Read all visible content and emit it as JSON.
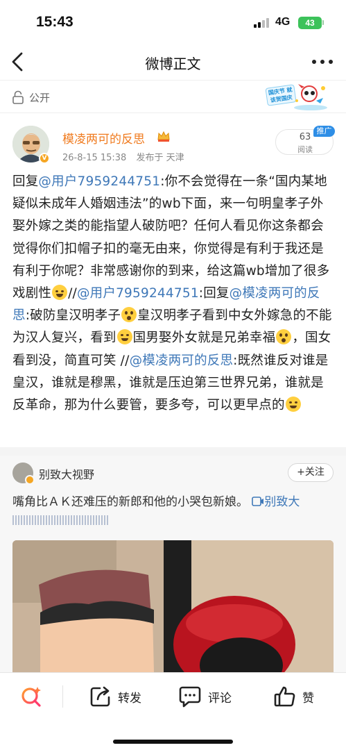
{
  "status_bar": {
    "time": "15:43",
    "network": "4G",
    "battery": "43"
  },
  "nav": {
    "title": "微博正文",
    "back_icon": "chevron-left-icon",
    "more_icon": "more-dots-icon"
  },
  "visibility": {
    "label": "公开",
    "icon": "lock-icon",
    "banner_text": "国庆节 就该贺国庆"
  },
  "post": {
    "author": "模凌两可的反思",
    "date": "26-8-15 15:38",
    "location": "发布于 天津",
    "read_count": "63",
    "read_label": "阅读",
    "promote_tag": "推广",
    "body": {
      "p1": "回复",
      "m1": "@用户7959244751",
      "p2": ":你不会觉得在一条“国内某地疑似未成年人婚姻违法”的wb下面，来一句明皇孝子外娶外嫁之类的能指望人破防吧？任何人看见你这条都会觉得你们扣帽子扣的毫无由来，你觉得是有利于我还是有利于你呢？非常感谢你的到来，给这篇wb增加了很多戏剧性",
      "p3": "//",
      "m2": "@用户7959244751",
      "p4": ":回复",
      "m3": "@模凌两可的反思",
      "p5": ":破防皇汉明孝子",
      "p6": "皇汉明孝子看到中女外嫁急的不能为汉人复兴，看到",
      "p7": "国男娶外女就是兄弟幸福",
      "p8": "，国女看到没，简直可笑 //",
      "m4": "@模凌两可的反思",
      "p9": ":既然谁反对谁是皇汉，谁就是穆黑，谁就是压迫第三世界兄弟，谁就是反革命，那为什么要管，要多夸，可以更早点的"
    }
  },
  "original": {
    "author": "别致大视野",
    "follow_label": "+关注",
    "text": "嘴角比ＡＫ还难压的新郎和他的小哭包新娘。",
    "video_link": "别致大"
  },
  "toolbar": {
    "repost": "转发",
    "comment": "评论",
    "like": "赞"
  },
  "colors": {
    "accent": "#f07b1f",
    "link": "#3f78b8",
    "battery": "#3cc25a"
  }
}
